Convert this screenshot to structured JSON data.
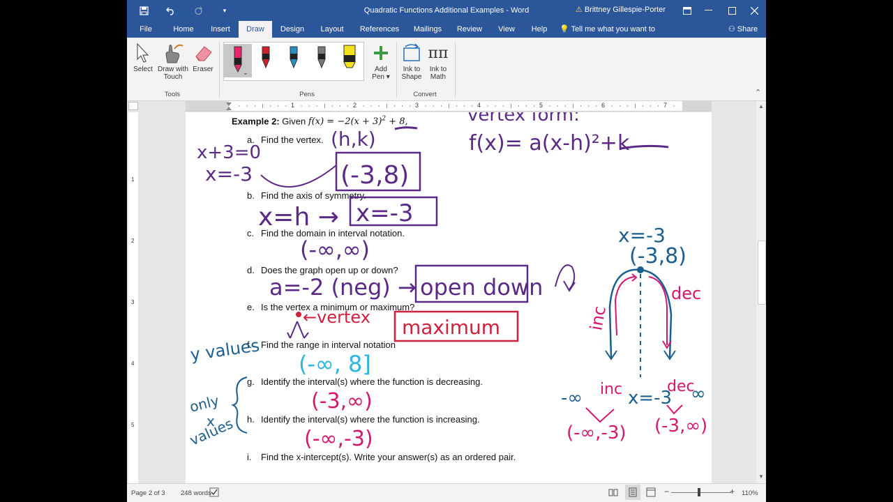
{
  "title_bar": {
    "document_title": "Quadratic Functions Additional Examples  -  Word",
    "user_name": "Brittney Gillespie-Porter",
    "user_icon": "warning-icon"
  },
  "tabs": [
    {
      "label": "File"
    },
    {
      "label": "Home"
    },
    {
      "label": "Insert"
    },
    {
      "label": "Draw"
    },
    {
      "label": "Design"
    },
    {
      "label": "Layout"
    },
    {
      "label": "References"
    },
    {
      "label": "Mailings"
    },
    {
      "label": "Review"
    },
    {
      "label": "View"
    },
    {
      "label": "Help"
    }
  ],
  "tell_me": "Tell me what you want to do",
  "share_label": "Share",
  "ribbon": {
    "tools": {
      "select": "Select",
      "draw_with_touch_1": "Draw with",
      "draw_with_touch_2": "Touch",
      "eraser": "Eraser",
      "group_label": "Tools"
    },
    "pens": {
      "add_pen_1": "Add",
      "add_pen_2": "Pen",
      "group_label": "Pens",
      "colors": [
        "#e8266d",
        "#d0202c",
        "#2a8ec2",
        "#7a7a7a",
        "#f6e21a"
      ]
    },
    "convert": {
      "ink_to_shape_1": "Ink to",
      "ink_to_shape_2": "Shape",
      "ink_to_math_1": "Ink to",
      "ink_to_math_2": "Math",
      "group_label": "Convert"
    }
  },
  "ruler_numbers": [
    "1",
    "2",
    "3",
    "4",
    "5",
    "6",
    "7"
  ],
  "vruler_numbers": [
    "1",
    "2",
    "3",
    "4",
    "5"
  ],
  "document": {
    "example_label": "Example 2:",
    "example_given": "Given",
    "function_expr": "f(x) = −2(x + 3)",
    "function_exp": "2",
    "function_tail": " + 8,",
    "questions": [
      {
        "letter": "a.",
        "text": "Find the vertex."
      },
      {
        "letter": "b.",
        "text": "Find the axis of symmetry."
      },
      {
        "letter": "c.",
        "text": "Find the domain in interval notation."
      },
      {
        "letter": "d.",
        "text": "Does the graph open up or down?"
      },
      {
        "letter": "e.",
        "text": "Is the vertex a minimum or maximum?"
      },
      {
        "letter": "f.",
        "text": "Find the range in interval notation"
      },
      {
        "letter": "g.",
        "text": "Identify the interval(s) where the function is decreasing."
      },
      {
        "letter": "h.",
        "text": "Identify the interval(s) where the function is increasing."
      },
      {
        "letter": "i.",
        "text": "Find the x-intercept(s). Write your answer(s) as an ordered pair."
      }
    ]
  },
  "ink": {
    "vertex_form_header": "vertex form:",
    "vertex_form": "f(x)= a(x-h)²+k",
    "x_plus_3": "x+3=0",
    "x_eq": "x=-3",
    "hk": "(h,k)",
    "vertex_answer": "(-3,8)",
    "axis_work": "x=h →",
    "axis_answer": "x=-3",
    "domain_answer": "(-∞,∞)",
    "open_work": "a=-2 (neg) →",
    "open_answer": "open down",
    "vertex_word": "←vertex",
    "max_answer": "maximum",
    "y_values": "y values",
    "range_answer": "(-∞, 8]",
    "only_x_values_1": "only",
    "only_x_values_2": "x",
    "only_x_values_3": "values",
    "dec_answer": "(-3,∞)",
    "inc_answer": "(-∞,-3)",
    "graph_axis": "x=-3",
    "graph_vertex": "(-3,8)",
    "graph_inc": "inc",
    "graph_dec": "dec",
    "line_neg_inf": "-∞",
    "line_inc": "inc",
    "line_x": "x=-3",
    "line_dec": "dec",
    "line_pos_inf": "∞",
    "line_inc_interval": "(-∞,-3)",
    "line_dec_interval": "(-3,∞)",
    "colors": {
      "purple": "#5b2a86",
      "red": "#d21f3c",
      "blue": "#1a5f8e",
      "cyan": "#2bb4e0",
      "pink": "#d6186c"
    }
  },
  "status_bar": {
    "page": "Page 2 of 3",
    "words": "248 words",
    "zoom": "110%"
  }
}
